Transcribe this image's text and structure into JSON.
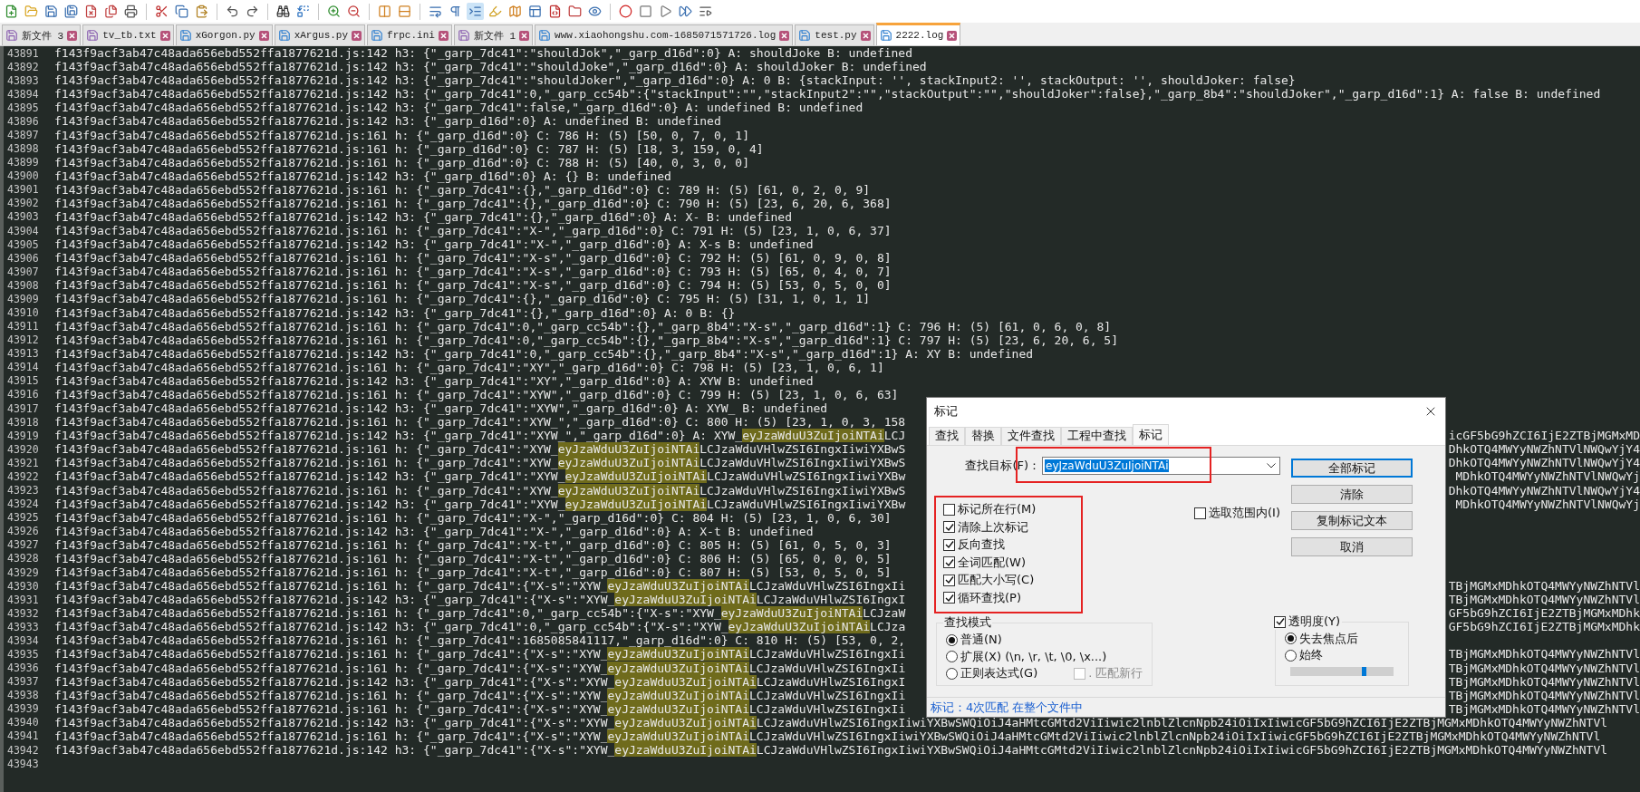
{
  "tabs": [
    {
      "label": "新文件 3",
      "selected": false,
      "unsaved": true
    },
    {
      "label": "tv_tb.txt",
      "selected": false,
      "unsaved": true
    },
    {
      "label": "xGorgon.py",
      "selected": false,
      "unsaved": false
    },
    {
      "label": "xArgus.py",
      "selected": false,
      "unsaved": false
    },
    {
      "label": "frpc.ini",
      "selected": false,
      "unsaved": false
    },
    {
      "label": "新文件 1",
      "selected": false,
      "unsaved": true
    },
    {
      "label": "www.xiaohongshu.com-1685071571726.log",
      "selected": false,
      "unsaved": false
    },
    {
      "label": "test.py",
      "selected": false,
      "unsaved": false
    },
    {
      "label": "2222.log",
      "selected": true,
      "unsaved": false
    }
  ],
  "editor": {
    "lines": [
      {
        "number": "43891",
        "parts": [
          {
            "text": "f143f9acf3ab47c48ada656ebd552ffa1877621d.js:142 h3: {\"_garp_7dc41\":\"shouldJok\",\"_garp_d16d\":0} A: shouldJoke B: undefined",
            "marked": false
          }
        ]
      },
      {
        "number": "43892",
        "parts": [
          {
            "text": "f143f9acf3ab47c48ada656ebd552ffa1877621d.js:142 h3: {\"_garp_7dc41\":\"shouldJoke\",\"_garp_d16d\":0} A: shouldJoker B: undefined",
            "marked": false
          }
        ]
      },
      {
        "number": "43893",
        "parts": [
          {
            "text": "f143f9acf3ab47c48ada656ebd552ffa1877621d.js:142 h3: {\"_garp_7dc41\":\"shouldJoker\",\"_garp_d16d\":0} A: 0 B: {stackInput: '', stackInput2: '', stackOutput: '', shouldJoker: false}",
            "marked": false
          }
        ]
      },
      {
        "number": "43894",
        "parts": [
          {
            "text": "f143f9acf3ab47c48ada656ebd552ffa1877621d.js:142 h3: {\"_garp_7dc41\":0,\"_garp_cc54b\":{\"stackInput\":\"\",\"stackInput2\":\"\",\"stackOutput\":\"\",\"shouldJoker\":false},\"_garp_8b4\":\"shouldJoker\",\"_garp_d16d\":1} A: false B: undefined",
            "marked": false
          }
        ]
      },
      {
        "number": "43895",
        "parts": [
          {
            "text": "f143f9acf3ab47c48ada656ebd552ffa1877621d.js:142 h3: {\"_garp_7dc41\":false,\"_garp_d16d\":0} A: undefined B: undefined",
            "marked": false
          }
        ]
      },
      {
        "number": "43896",
        "parts": [
          {
            "text": "f143f9acf3ab47c48ada656ebd552ffa1877621d.js:142 h3: {\"_garp_d16d\":0} A: undefined B: undefined",
            "marked": false
          }
        ]
      },
      {
        "number": "43897",
        "parts": [
          {
            "text": "f143f9acf3ab47c48ada656ebd552ffa1877621d.js:161 h: {\"_garp_d16d\":0} C: 786 H: (5) [50, 0, 7, 0, 1]",
            "marked": false
          }
        ]
      },
      {
        "number": "43898",
        "parts": [
          {
            "text": "f143f9acf3ab47c48ada656ebd552ffa1877621d.js:161 h: {\"_garp_d16d\":0} C: 787 H: (5) [18, 3, 159, 0, 4]",
            "marked": false
          }
        ]
      },
      {
        "number": "43899",
        "parts": [
          {
            "text": "f143f9acf3ab47c48ada656ebd552ffa1877621d.js:161 h: {\"_garp_d16d\":0} C: 788 H: (5) [40, 0, 3, 0, 0]",
            "marked": false
          }
        ]
      },
      {
        "number": "43900",
        "parts": [
          {
            "text": "f143f9acf3ab47c48ada656ebd552ffa1877621d.js:142 h3: {\"_garp_d16d\":0} A: {} B: undefined",
            "marked": false
          }
        ]
      },
      {
        "number": "43901",
        "parts": [
          {
            "text": "f143f9acf3ab47c48ada656ebd552ffa1877621d.js:161 h: {\"_garp_7dc41\":{},\"_garp_d16d\":0} C: 789 H: (5) [61, 0, 2, 0, 9]",
            "marked": false
          }
        ]
      },
      {
        "number": "43902",
        "parts": [
          {
            "text": "f143f9acf3ab47c48ada656ebd552ffa1877621d.js:161 h: {\"_garp_7dc41\":{},\"_garp_d16d\":0} C: 790 H: (5) [23, 6, 20, 6, 368]",
            "marked": false
          }
        ]
      },
      {
        "number": "43903",
        "parts": [
          {
            "text": "f143f9acf3ab47c48ada656ebd552ffa1877621d.js:142 h3: {\"_garp_7dc41\":{},\"_garp_d16d\":0} A: X- B: undefined",
            "marked": false
          }
        ]
      },
      {
        "number": "43904",
        "parts": [
          {
            "text": "f143f9acf3ab47c48ada656ebd552ffa1877621d.js:161 h: {\"_garp_7dc41\":\"X-\",\"_garp_d16d\":0} C: 791 H: (5) [23, 1, 0, 6, 37]",
            "marked": false
          }
        ]
      },
      {
        "number": "43905",
        "parts": [
          {
            "text": "f143f9acf3ab47c48ada656ebd552ffa1877621d.js:142 h3: {\"_garp_7dc41\":\"X-\",\"_garp_d16d\":0} A: X-s B: undefined",
            "marked": false
          }
        ]
      },
      {
        "number": "43906",
        "parts": [
          {
            "text": "f143f9acf3ab47c48ada656ebd552ffa1877621d.js:161 h: {\"_garp_7dc41\":\"X-s\",\"_garp_d16d\":0} C: 792 H: (5) [61, 0, 9, 0, 8]",
            "marked": false
          }
        ]
      },
      {
        "number": "43907",
        "parts": [
          {
            "text": "f143f9acf3ab47c48ada656ebd552ffa1877621d.js:161 h: {\"_garp_7dc41\":\"X-s\",\"_garp_d16d\":0} C: 793 H: (5) [65, 0, 4, 0, 7]",
            "marked": false
          }
        ]
      },
      {
        "number": "43908",
        "parts": [
          {
            "text": "f143f9acf3ab47c48ada656ebd552ffa1877621d.js:161 h: {\"_garp_7dc41\":\"X-s\",\"_garp_d16d\":0} C: 794 H: (5) [53, 0, 5, 0, 0]",
            "marked": false
          }
        ]
      },
      {
        "number": "43909",
        "parts": [
          {
            "text": "f143f9acf3ab47c48ada656ebd552ffa1877621d.js:161 h: {\"_garp_7dc41\":{},\"_garp_d16d\":0} C: 795 H: (5) [31, 1, 0, 1, 1]",
            "marked": false
          }
        ]
      },
      {
        "number": "43910",
        "parts": [
          {
            "text": "f143f9acf3ab47c48ada656ebd552ffa1877621d.js:142 h3: {\"_garp_7dc41\":{},\"_garp_d16d\":0} A: 0 B: {}",
            "marked": false
          }
        ]
      },
      {
        "number": "43911",
        "parts": [
          {
            "text": "f143f9acf3ab47c48ada656ebd552ffa1877621d.js:161 h: {\"_garp_7dc41\":0,\"_garp_cc54b\":{},\"_garp_8b4\":\"X-s\",\"_garp_d16d\":1} C: 796 H: (5) [61, 0, 6, 0, 8]",
            "marked": false
          }
        ]
      },
      {
        "number": "43912",
        "parts": [
          {
            "text": "f143f9acf3ab47c48ada656ebd552ffa1877621d.js:161 h: {\"_garp_7dc41\":0,\"_garp_cc54b\":{},\"_garp_8b4\":\"X-s\",\"_garp_d16d\":1} C: 797 H: (5) [23, 6, 20, 6, 5]",
            "marked": false
          }
        ]
      },
      {
        "number": "43913",
        "parts": [
          {
            "text": "f143f9acf3ab47c48ada656ebd552ffa1877621d.js:142 h3: {\"_garp_7dc41\":0,\"_garp_cc54b\":{},\"_garp_8b4\":\"X-s\",\"_garp_d16d\":1} A: XY B: undefined",
            "marked": false
          }
        ]
      },
      {
        "number": "43914",
        "parts": [
          {
            "text": "f143f9acf3ab47c48ada656ebd552ffa1877621d.js:161 h: {\"_garp_7dc41\":\"XY\",\"_garp_d16d\":0} C: 798 H: (5) [23, 1, 0, 6, 1]",
            "marked": false
          }
        ]
      },
      {
        "number": "43915",
        "parts": [
          {
            "text": "f143f9acf3ab47c48ada656ebd552ffa1877621d.js:142 h3: {\"_garp_7dc41\":\"XY\",\"_garp_d16d\":0} A: XYW B: undefined",
            "marked": false
          }
        ]
      },
      {
        "number": "43916",
        "parts": [
          {
            "text": "f143f9acf3ab47c48ada656ebd552ffa1877621d.js:161 h: {\"_garp_7dc41\":\"XYW\",\"_garp_d16d\":0} C: 799 H: (5) [23, 1, 0, 6, 63]",
            "marked": false
          }
        ]
      },
      {
        "number": "43917",
        "parts": [
          {
            "text": "f143f9acf3ab47c48ada656ebd552ffa1877621d.js:142 h3: {\"_garp_7dc41\":\"XYW\",\"_garp_d16d\":0} A: XYW_ B: undefined",
            "marked": false
          }
        ]
      },
      {
        "number": "43918",
        "parts": [
          {
            "text": "f143f9acf3ab47c48ada656ebd552ffa1877621d.js:161 h: {\"_garp_7dc41\":\"XYW_\",\"_garp_d16d\":0} C: 800 H: (5) [23, 1, 0, 3, 158",
            "marked": false
          }
        ]
      },
      {
        "number": "43919",
        "parts": [
          {
            "text": "f143f9acf3ab47c48ada656ebd552ffa1877621d.js:142 h3: {\"_garp_7dc41\":\"XYW_\",\"_garp_d16d\":0} A: XYW_",
            "marked": false
          },
          {
            "text": "eyJzaWduU3ZuIjoiNTAi",
            "marked": true
          },
          {
            "text": "LCJ",
            "marked": false
          }
        ],
        "tail": "icGF5bG9hZCI6IjE2ZTBjMGMxMD"
      },
      {
        "number": "43920",
        "parts": [
          {
            "text": "f143f9acf3ab47c48ada656ebd552ffa1877621d.js:161 h: {\"_garp_7dc41\":\"XYW_",
            "marked": false
          },
          {
            "text": "eyJzaWduU3ZuIjoiNTAi",
            "marked": true
          },
          {
            "text": "LCJzaWduVHlwZSI6IngxIiwiYXBwS",
            "marked": false
          }
        ],
        "tail": "DhkOTQ4MWYyNWZhNTVlNWQwYjY4"
      },
      {
        "number": "43921",
        "parts": [
          {
            "text": "f143f9acf3ab47c48ada656ebd552ffa1877621d.js:161 h: {\"_garp_7dc41\":\"XYW_",
            "marked": false
          },
          {
            "text": "eyJzaWduU3ZuIjoiNTAi",
            "marked": true
          },
          {
            "text": "LCJzaWduVHlwZSI6IngxIiwiYXBwS",
            "marked": false
          }
        ],
        "tail": "DhkOTQ4MWYyNWZhNTVlNWQwYjY4"
      },
      {
        "number": "43922",
        "parts": [
          {
            "text": "f143f9acf3ab47c48ada656ebd552ffa1877621d.js:142 h3: {\"_garp_7dc41\":\"XYW_",
            "marked": false
          },
          {
            "text": "eyJzaWduU3ZuIjoiNTAi",
            "marked": true
          },
          {
            "text": "LCJzaWduVHlwZSI6IngxIiwiYXBw",
            "marked": false
          }
        ],
        "tail": "MDhkOTQ4MWYyNWZhNTVlNWQwYj"
      },
      {
        "number": "43923",
        "parts": [
          {
            "text": "f143f9acf3ab47c48ada656ebd552ffa1877621d.js:161 h: {\"_garp_7dc41\":\"XYW_",
            "marked": false
          },
          {
            "text": "eyJzaWduU3ZuIjoiNTAi",
            "marked": true
          },
          {
            "text": "LCJzaWduVHlwZSI6IngxIiwiYXBwS",
            "marked": false
          }
        ],
        "tail": "DhkOTQ4MWYyNWZhNTVlNWQwYjY4"
      },
      {
        "number": "43924",
        "parts": [
          {
            "text": "f143f9acf3ab47c48ada656ebd552ffa1877621d.js:142 h3: {\"_garp_7dc41\":\"XYW_",
            "marked": false
          },
          {
            "text": "eyJzaWduU3ZuIjoiNTAi",
            "marked": true
          },
          {
            "text": "LCJzaWduVHlwZSI6IngxIiwiYXBw",
            "marked": false
          }
        ],
        "tail": "MDhkOTQ4MWYyNWZhNTVlNWQwYj"
      },
      {
        "number": "43925",
        "parts": [
          {
            "text": "f143f9acf3ab47c48ada656ebd552ffa1877621d.js:161 h: {\"_garp_7dc41\":\"X-\",\"_garp_d16d\":0} C: 804 H: (5) [23, 1, 0, 6, 30]",
            "marked": false
          }
        ]
      },
      {
        "number": "43926",
        "parts": [
          {
            "text": "f143f9acf3ab47c48ada656ebd552ffa1877621d.js:142 h3: {\"_garp_7dc41\":\"X-\",\"_garp_d16d\":0} A: X-t B: undefined",
            "marked": false
          }
        ]
      },
      {
        "number": "43927",
        "parts": [
          {
            "text": "f143f9acf3ab47c48ada656ebd552ffa1877621d.js:161 h: {\"_garp_7dc41\":\"X-t\",\"_garp_d16d\":0} C: 805 H: (5) [61, 0, 5, 0, 3]",
            "marked": false
          }
        ]
      },
      {
        "number": "43928",
        "parts": [
          {
            "text": "f143f9acf3ab47c48ada656ebd552ffa1877621d.js:161 h: {\"_garp_7dc41\":\"X-t\",\"_garp_d16d\":0} C: 806 H: (5) [65, 0, 0, 0, 5]",
            "marked": false
          }
        ]
      },
      {
        "number": "43929",
        "parts": [
          {
            "text": "f143f9acf3ab47c48ada656ebd552ffa1877621d.js:161 h: {\"_garp_7dc41\":\"X-t\",\"_garp_d16d\":0} C: 807 H: (5) [53, 0, 5, 0, 5]",
            "marked": false
          }
        ]
      },
      {
        "number": "43930",
        "parts": [
          {
            "text": "f143f9acf3ab47c48ada656ebd552ffa1877621d.js:161 h: {\"_garp_7dc41\":{\"X-s\":\"XYW_",
            "marked": false
          },
          {
            "text": "eyJzaWduU3ZuIjoiNTAi",
            "marked": true
          },
          {
            "text": "LCJzaWduVHlwZSI6IngxIi",
            "marked": false
          }
        ],
        "tail": "TBjMGMxMDhkOTQ4MWYyNWZhNTVl"
      },
      {
        "number": "43931",
        "parts": [
          {
            "text": "f143f9acf3ab47c48ada656ebd552ffa1877621d.js:142 h3: {\"_garp_7dc41\":{\"X-s\":\"XYW_",
            "marked": false
          },
          {
            "text": "eyJzaWduU3ZuIjoiNTAi",
            "marked": true
          },
          {
            "text": "LCJzaWduVHlwZSI6IngxI",
            "marked": false
          }
        ],
        "tail": "TBjMGMxMDhkOTQ4MWYyNWZhNTVl"
      },
      {
        "number": "43932",
        "parts": [
          {
            "text": "f143f9acf3ab47c48ada656ebd552ffa1877621d.js:161 h: {\"_garp_7dc41\":0,\"_garp_cc54b\":{\"X-s\":\"XYW_",
            "marked": false
          },
          {
            "text": "eyJzaWduU3ZuIjoiNTAi",
            "marked": true
          },
          {
            "text": "LCJzaW",
            "marked": false
          }
        ],
        "tail": "GF5bG9hZCI6IjE2ZTBjMGMxMDhk"
      },
      {
        "number": "43933",
        "parts": [
          {
            "text": "f143f9acf3ab47c48ada656ebd552ffa1877621d.js:142 h3: {\"_garp_7dc41\":0,\"_garp_cc54b\":{\"X-s\":\"XYW_",
            "marked": false
          },
          {
            "text": "eyJzaWduU3ZuIjoiNTAi",
            "marked": true
          },
          {
            "text": "LCJza",
            "marked": false
          }
        ],
        "tail": "GF5bG9hZCI6IjE2ZTBjMGMxMDhk"
      },
      {
        "number": "43934",
        "parts": [
          {
            "text": "f143f9acf3ab47c48ada656ebd552ffa1877621d.js:161 h: {\"_garp_7dc41\":1685085841117,\"_garp_d16d\":0} C: 810 H: (5) [53, 0, 2,",
            "marked": false
          }
        ]
      },
      {
        "number": "43935",
        "parts": [
          {
            "text": "f143f9acf3ab47c48ada656ebd552ffa1877621d.js:161 h: {\"_garp_7dc41\":{\"X-s\":\"XYW_",
            "marked": false
          },
          {
            "text": "eyJzaWduU3ZuIjoiNTAi",
            "marked": true
          },
          {
            "text": "LCJzaWduVHlwZSI6IngxIi",
            "marked": false
          }
        ],
        "tail": "TBjMGMxMDhkOTQ4MWYyNWZhNTVl"
      },
      {
        "number": "43936",
        "parts": [
          {
            "text": "f143f9acf3ab47c48ada656ebd552ffa1877621d.js:161 h: {\"_garp_7dc41\":{\"X-s\":\"XYW_",
            "marked": false
          },
          {
            "text": "eyJzaWduU3ZuIjoiNTAi",
            "marked": true
          },
          {
            "text": "LCJzaWduVHlwZSI6IngxIi",
            "marked": false
          }
        ],
        "tail": "TBjMGMxMDhkOTQ4MWYyNWZhNTVl"
      },
      {
        "number": "43937",
        "parts": [
          {
            "text": "f143f9acf3ab47c48ada656ebd552ffa1877621d.js:142 h3: {\"_garp_7dc41\":{\"X-s\":\"XYW_",
            "marked": false
          },
          {
            "text": "eyJzaWduU3ZuIjoiNTAi",
            "marked": true
          },
          {
            "text": "LCJzaWduVHlwZSI6IngxI",
            "marked": false
          }
        ],
        "tail": "TBjMGMxMDhkOTQ4MWYyNWZhNTVl"
      },
      {
        "number": "43938",
        "parts": [
          {
            "text": "f143f9acf3ab47c48ada656ebd552ffa1877621d.js:161 h: {\"_garp_7dc41\":{\"X-s\":\"XYW_",
            "marked": false
          },
          {
            "text": "eyJzaWduU3ZuIjoiNTAi",
            "marked": true
          },
          {
            "text": "LCJzaWduVHlwZSI6IngxIi",
            "marked": false
          }
        ],
        "tail": "TBjMGMxMDhkOTQ4MWYyNWZhNTVl"
      },
      {
        "number": "43939",
        "parts": [
          {
            "text": "f143f9acf3ab47c48ada656ebd552ffa1877621d.js:161 h: {\"_garp_7dc41\":{\"X-s\":\"XYW_",
            "marked": false
          },
          {
            "text": "eyJzaWduU3ZuIjoiNTAi",
            "marked": true
          },
          {
            "text": "LCJzaWduVHlwZSI6IngxIi",
            "marked": false
          }
        ],
        "tail": "TBjMGMxMDhkOTQ4MWYyNWZhNTVl"
      },
      {
        "number": "43940",
        "parts": [
          {
            "text": "f143f9acf3ab47c48ada656ebd552ffa1877621d.js:142 h3: {\"_garp_7dc41\":{\"X-s\":\"XYW_",
            "marked": false
          },
          {
            "text": "eyJzaWduU3ZuIjoiNTAi",
            "marked": true
          },
          {
            "text": "LCJzaWduVHlwZSI6IngxIiwiYXBwSWQiOiJ4aHMtcGMtd2ViIiwic2lnblZlcnNpb24iOiIxIiwicGF5bG9hZCI6IjE2ZTBjMGMxMDhkOTQ4MWYyNWZhNTVl",
            "marked": false
          }
        ]
      },
      {
        "number": "43941",
        "parts": [
          {
            "text": "f143f9acf3ab47c48ada656ebd552ffa1877621d.js:161 h: {\"_garp_7dc41\":{\"X-s\":\"XYW_",
            "marked": false
          },
          {
            "text": "eyJzaWduU3ZuIjoiNTAi",
            "marked": true
          },
          {
            "text": "LCJzaWduVHlwZSI6IngxIiwiYXBwSWQiOiJ4aHMtcGMtd2ViIiwic2lnblZlcnNpb24iOiIxIiwicGF5bG9hZCI6IjE2ZTBjMGMxMDhkOTQ4MWYyNWZhNTVl",
            "marked": false
          }
        ]
      },
      {
        "number": "43942",
        "parts": [
          {
            "text": "f143f9acf3ab47c48ada656ebd552ffa1877621d.js:142 h3: {\"_garp_7dc41\":{\"X-s\":\"XYW_",
            "marked": false
          },
          {
            "text": "eyJzaWduU3ZuIjoiNTAi",
            "marked": true
          },
          {
            "text": "LCJzaWduVHlwZSI6IngxIiwiYXBwSWQiOiJ4aHMtcGMtd2ViIiwic2lnblZlcnNpb24iOiIxIiwicGF5bG9hZCI6IjE2ZTBjMGMxMDhkOTQ4MWYyNWZhNTVl",
            "marked": false
          }
        ]
      },
      {
        "number": "43943"
      }
    ]
  },
  "mark_dialog": {
    "title": "标记",
    "tabs": [
      {
        "label": "查找",
        "selected": false
      },
      {
        "label": "替换",
        "selected": false
      },
      {
        "label": "文件查找",
        "selected": false
      },
      {
        "label": "工程中查找",
        "selected": false
      },
      {
        "label": "标记",
        "selected": true
      }
    ],
    "find_label": "查找目标(F)：",
    "find_value": "eyJzaWduU3ZuIjoiNTAi",
    "buttons": [
      {
        "label": "全部标记",
        "default": true
      },
      {
        "label": "清除",
        "default": false
      },
      {
        "label": "复制标记文本",
        "default": false
      },
      {
        "label": "取消",
        "default": false
      }
    ],
    "options": [
      {
        "label": "标记所在行(M)",
        "checked": false
      },
      {
        "label": "清除上次标记",
        "checked": true
      },
      {
        "label": "反向查找",
        "checked": true
      },
      {
        "label": "全词匹配(W)",
        "checked": true
      },
      {
        "label": "匹配大小写(C)",
        "checked": true
      },
      {
        "label": "循环查找(P)",
        "checked": true
      }
    ],
    "in_selection": {
      "label": "选取范围内(I)",
      "checked": false
    },
    "search_mode": {
      "title": "查找模式",
      "options": [
        {
          "label": "普通(N)",
          "selected": true
        },
        {
          "label": "扩展(X) (\\n, \\r, \\t, \\0, \\x...)",
          "selected": false
        },
        {
          "label": "正则表达式(G)",
          "selected": false
        }
      ],
      "dot_newline": {
        "label": ". 匹配新行",
        "checked": false,
        "disabled": true
      }
    },
    "transparency": {
      "label": "透明度(Y)",
      "checked": true,
      "options": [
        {
          "label": "失去焦点后",
          "selected": true
        },
        {
          "label": "始终",
          "selected": false
        }
      ],
      "level": 0.71
    },
    "status": "标记：4次匹配 在整个文件中"
  }
}
